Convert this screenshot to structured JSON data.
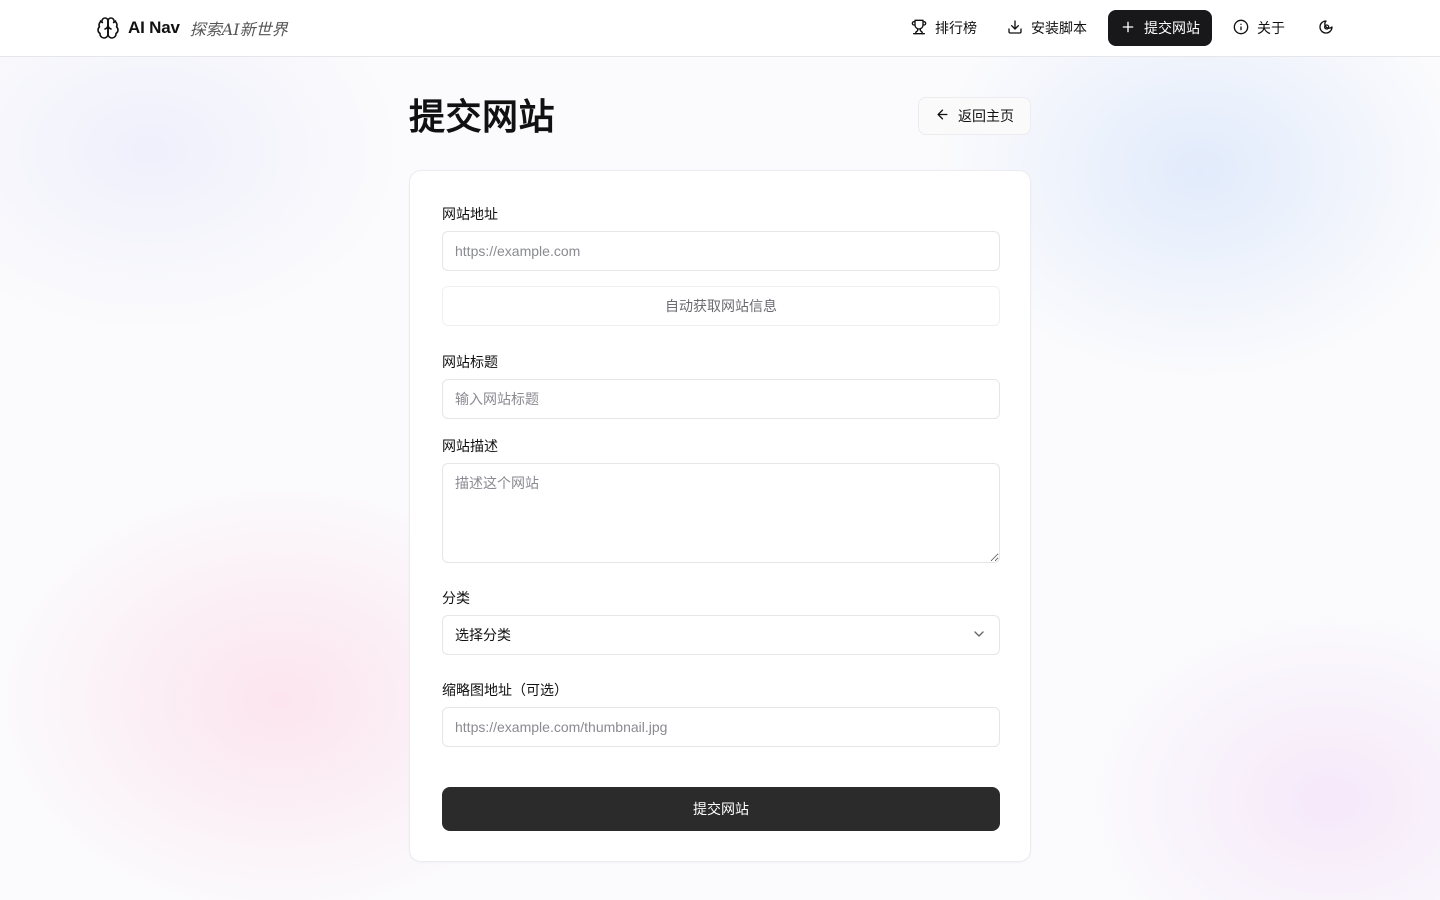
{
  "header": {
    "brand_name": "AI Nav",
    "brand_tagline": "探索AI新世界",
    "brand_icon": "brain-icon",
    "nav": {
      "leaderboard": {
        "label": "排行榜",
        "icon": "trophy-icon"
      },
      "install_script": {
        "label": "安装脚本",
        "icon": "download-icon"
      },
      "submit_site": {
        "label": "提交网站",
        "icon": "plus-icon"
      },
      "about": {
        "label": "关于",
        "icon": "info-icon"
      },
      "theme_toggle": {
        "icon": "theme-toggle-icon"
      }
    }
  },
  "page": {
    "title": "提交网站",
    "back_button": {
      "label": "返回主页",
      "icon": "arrow-left-icon"
    }
  },
  "form": {
    "url": {
      "label": "网站地址",
      "placeholder": "https://example.com",
      "value": ""
    },
    "fetch_button": "自动获取网站信息",
    "title": {
      "label": "网站标题",
      "placeholder": "输入网站标题",
      "value": ""
    },
    "description": {
      "label": "网站描述",
      "placeholder": "描述这个网站",
      "value": ""
    },
    "category": {
      "label": "分类",
      "selected": "选择分类"
    },
    "thumbnail": {
      "label": "缩略图地址（可选）",
      "placeholder": "https://example.com/thumbnail.jpg",
      "value": ""
    },
    "submit_button": "提交网站"
  },
  "colors": {
    "primary_button": "#18181b",
    "submit_button": "#2b2b2b",
    "border": "#e6e6ea",
    "placeholder": "#8a8a92"
  }
}
